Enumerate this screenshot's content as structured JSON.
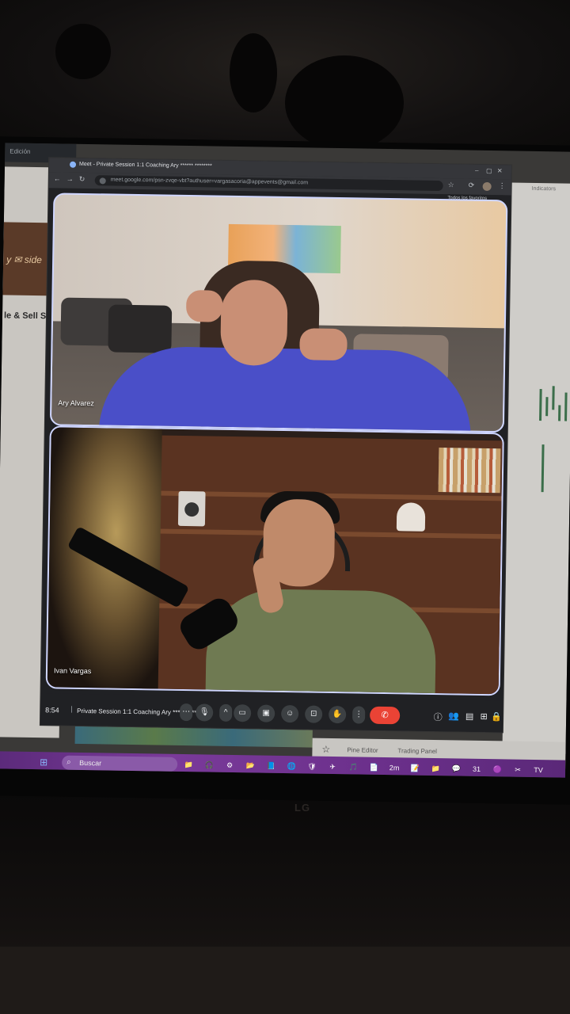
{
  "browser": {
    "background_tab": "Edición",
    "tab_title": "Meet - Private Session 1:1 Coaching Ary ****** ********",
    "url": "meet.google.com/psn-zvqe-vbt?authuser=vargasacoria@appevents@gmail.com",
    "bookmarks_label": "Todos los favoritos"
  },
  "background_apps": {
    "left_banner_text": "y ✉ side",
    "left_doc_text": "le & Sell S",
    "indicators_label": "Indicators",
    "tv_tabs": [
      "Pine Editor",
      "Trading Panel"
    ]
  },
  "participants": [
    {
      "name": "Ary Alvarez"
    },
    {
      "name": "Ivan Vargas"
    }
  ],
  "meeting": {
    "time": "8:54",
    "separator": "|",
    "title": "Private Session 1:1 Coaching Ary ****** ********"
  },
  "controls": {
    "more_dots": "⋯",
    "mic": "🎙",
    "chevron": "^",
    "camera": "▭",
    "captions": "▣",
    "emoji": "☺",
    "present": "⊡",
    "raise_hand": "✋",
    "more": "⋮",
    "hangup": "✆"
  },
  "right_controls": [
    "ⓘ",
    "👥",
    "▤",
    "⊞",
    "🔒"
  ],
  "taskbar": {
    "search_placeholder": "Buscar",
    "icons": [
      "📁",
      "🎧",
      "⚙",
      "📂",
      "📘",
      "🌐",
      "🛡",
      "✈",
      "🎵",
      "📄",
      "2m",
      "📝",
      "📁",
      "💬",
      "31",
      "🟣",
      "✂",
      "TV"
    ]
  },
  "monitor_brand": "LG"
}
